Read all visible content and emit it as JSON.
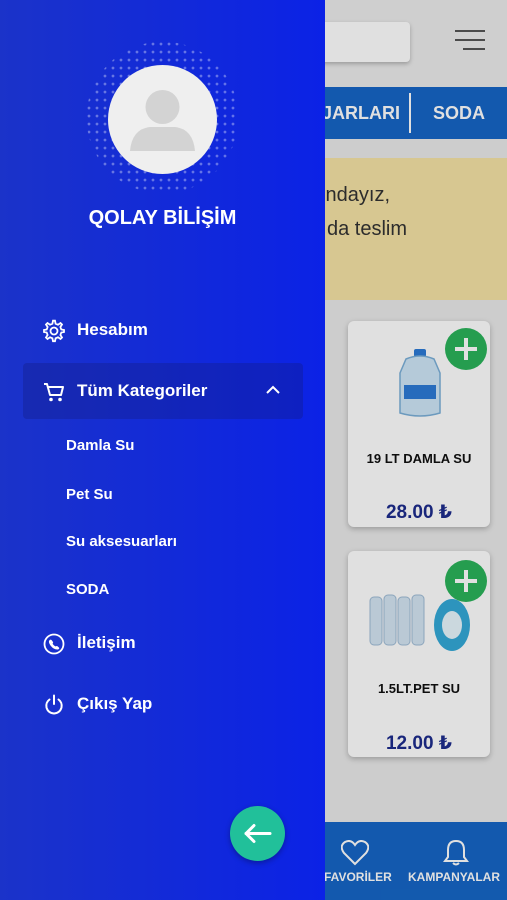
{
  "drawer": {
    "user_name": "QOLAY BİLİŞİM",
    "menu": [
      {
        "label": "Hesabım",
        "icon": "gear-icon"
      },
      {
        "label": "Tüm Kategoriler",
        "icon": "cart-icon"
      },
      {
        "label": "İletişim",
        "icon": "contact-icon"
      },
      {
        "label": "Çıkış Yap",
        "icon": "power-icon"
      }
    ],
    "subcategories": [
      "Damla Su",
      "Pet Su",
      "Su aksesuarları",
      "SODA"
    ],
    "back_icon": "arrow-left-icon",
    "colors": {
      "gradient_start": "#1b33c9",
      "gradient_end": "#0b22e6",
      "fab": "#21c09a"
    }
  },
  "background": {
    "categories": [
      "JARLARI",
      "SODA"
    ],
    "promo_lines": [
      "şındayız,",
      "da teslim"
    ],
    "products": [
      {
        "name": "19 LT DAMLA SU",
        "price": "28.00 ₺"
      },
      {
        "name": "1.5LT.PET SU",
        "price": "12.00 ₺"
      }
    ],
    "bottom_nav": [
      "FAVORİLER",
      "KAMPANYALAR"
    ],
    "colors": {
      "primary": "#1666c6",
      "add": "#2bb35a",
      "price": "#1d2c8c"
    }
  }
}
